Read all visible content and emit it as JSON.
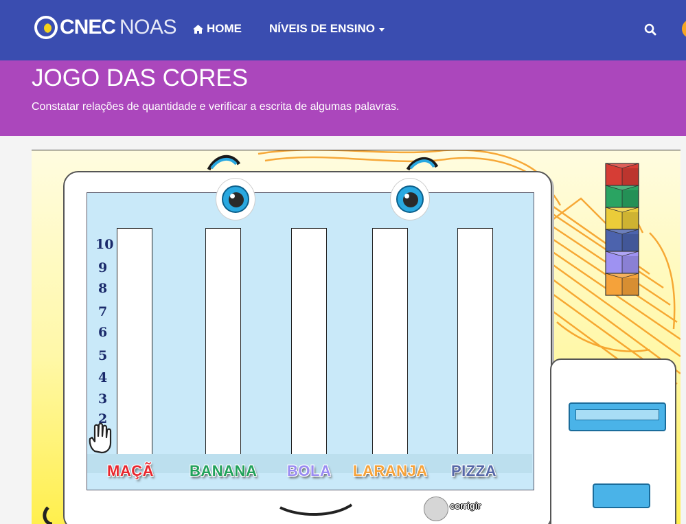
{
  "nav": {
    "logo_main": "CNEC",
    "logo_secondary": "NOAS",
    "home_label": "HOME",
    "niveis_label": "NÍVEIS DE ENSINO",
    "home_icon": "home-icon",
    "search_icon": "search-icon"
  },
  "banner": {
    "title": "JOGO DAS CORES",
    "subtitle": "Constatar relações de quantidade e verificar a escrita de algumas palavras."
  },
  "game": {
    "numbers": [
      "10",
      "9",
      "8",
      "7",
      "6",
      "5",
      "4",
      "3",
      "2"
    ],
    "words": [
      {
        "label": "MAÇÃ",
        "color": "#e8262d"
      },
      {
        "label": "BANANA",
        "color": "#21a15a"
      },
      {
        "label": "BOLA",
        "color": "#9a8cf2"
      },
      {
        "label": "LARANJA",
        "color": "#f5a23a"
      },
      {
        "label": "PIZZA",
        "color": "#5668a8"
      }
    ],
    "corrigir_label": "corrigir",
    "cube_colors": [
      "#d63d35",
      "#2aa462",
      "#ebcc39",
      "#4c63ad",
      "#9e92f2",
      "#f5a23a"
    ]
  }
}
